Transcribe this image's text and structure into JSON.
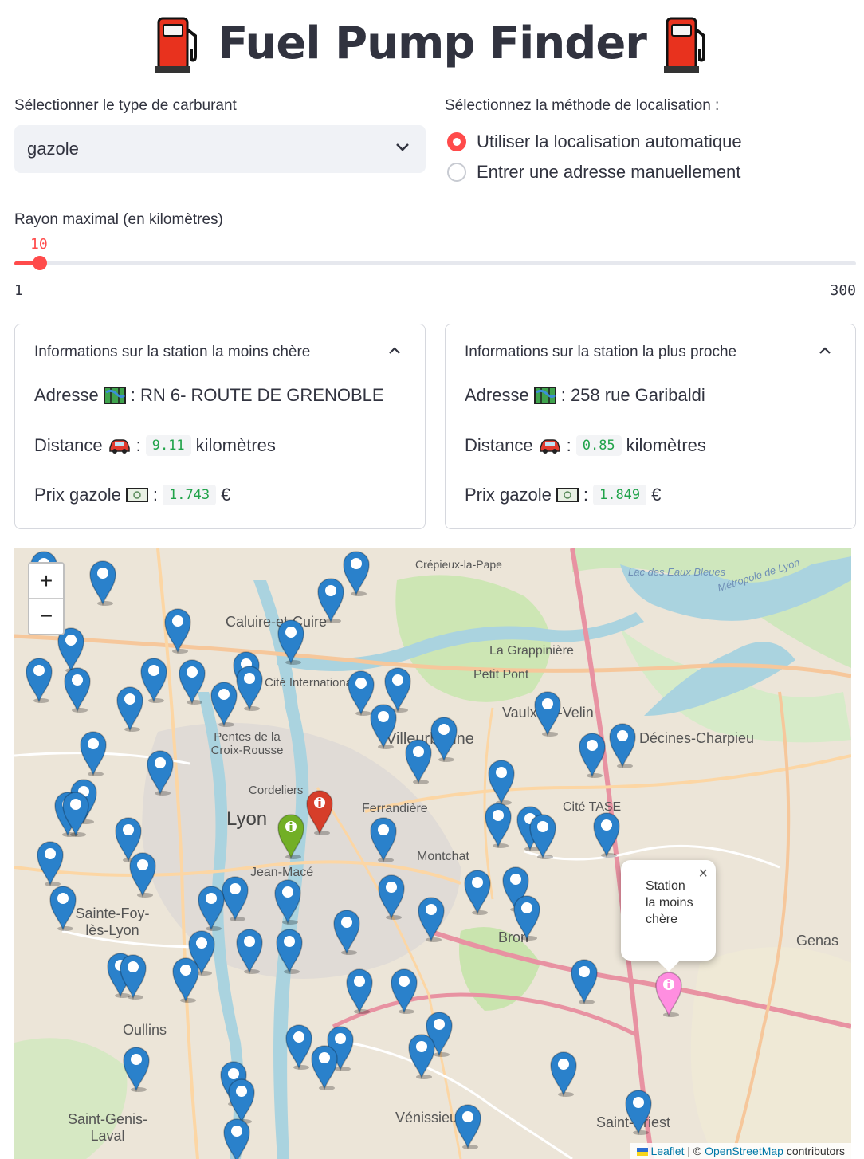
{
  "header": {
    "title": "Fuel Pump Finder",
    "icon": "fuel-pump-icon"
  },
  "fuel_select": {
    "label": "Sélectionner le type de carburant",
    "value": "gazole"
  },
  "location_method": {
    "label": "Sélectionnez la méthode de localisation :",
    "options": [
      {
        "label": "Utiliser la localisation automatique",
        "selected": true
      },
      {
        "label": "Entrer une adresse manuellement",
        "selected": false
      }
    ]
  },
  "radius_slider": {
    "label": "Rayon maximal (en kilomètres)",
    "value": "10",
    "min": "1",
    "max": "300",
    "value_num": 10,
    "min_num": 1,
    "max_num": 300,
    "accent": "#ff4b4b"
  },
  "cheapest": {
    "header": "Informations sur la station la moins chère",
    "address_label": "Adresse",
    "address": ": RN 6- ROUTE DE GRENOBLE",
    "distance_label": "Distance",
    "distance_value": "9.11",
    "distance_unit": "kilomètres",
    "price_label": "Prix gazole",
    "price_value": "1.743",
    "currency": "€"
  },
  "nearest": {
    "header": "Informations sur la station la plus proche",
    "address_label": "Adresse",
    "address": ": 258 rue Garibaldi",
    "distance_label": "Distance",
    "distance_value": "0.85",
    "distance_unit": "kilomètres",
    "price_label": "Prix gazole",
    "price_value": "1.849",
    "currency": "€"
  },
  "map": {
    "zoom_in": "+",
    "zoom_out": "−",
    "popup_text": "Station la moins chère",
    "popup_close": "×",
    "attribution_leaflet": "Leaflet",
    "attribution_sep": "| ©",
    "attribution_osm": "OpenStreetMap",
    "attribution_suffix": "contributors",
    "labels": {
      "lyon": "Lyon",
      "caluire": "Caluire-et-Cuire",
      "villeurbanne": "Villeurbanne",
      "vaulx": "Vaulx-en-Velin",
      "decines": "Décines-Charpieu",
      "bron": "Bron",
      "oullins": "Oullins",
      "sainte_foy": "Sainte-Foy-lès-Lyon",
      "saint_genis": "Saint-Genis-Laval",
      "venissieux": "Vénissieux",
      "saint_priest": "Saint-Priest",
      "genas": "Genas",
      "la_grappiniere": "La Grappinière",
      "petit_pont": "Petit Pont",
      "lac": "Lac des Eaux Bleues",
      "cite_tase": "Cité TASE",
      "montchat": "Montchat",
      "ferrandiere": "Ferrandière",
      "cordeliers": "Cordeliers",
      "jean_mace": "Jean-Macé",
      "pentes": "Pentes de la Croix-Rousse",
      "cite_internationale": "Cité Internationale",
      "crepieux": "Crépieux-la-Pape",
      "metropole": "Métropole de Lyon"
    },
    "marker_colors": {
      "default": "#2a81cb",
      "nearest": "#d63e2a",
      "user": "#72af26",
      "cheapest": "#ff8ee0"
    }
  }
}
